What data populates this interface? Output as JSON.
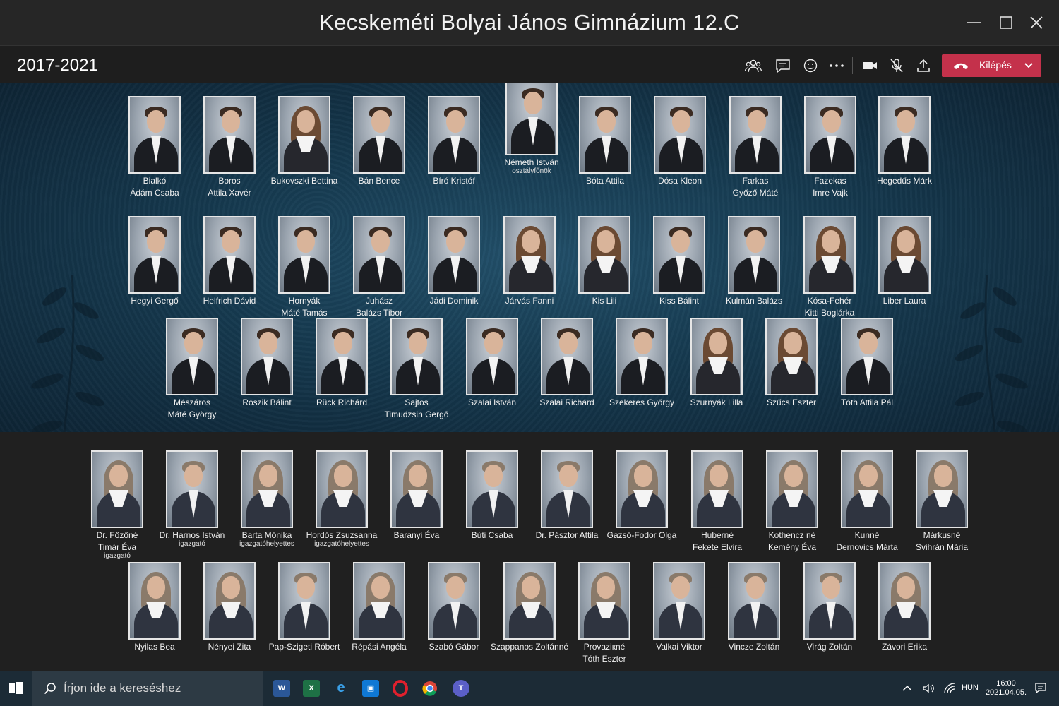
{
  "window": {
    "title": "Kecskeméti Bolyai János Gimnázium 12.C"
  },
  "meeting": {
    "date_range": "2017-2021",
    "leave_label": "Kilépés"
  },
  "students": [
    {
      "name": "Bialkó",
      "name2": "Ádám Csaba"
    },
    {
      "name": "Boros",
      "name2": "Attila Xavér"
    },
    {
      "name": "Bukovszki Bettina",
      "name2": ""
    },
    {
      "name": "Bán Bence",
      "name2": ""
    },
    {
      "name": "Bíró Kristóf",
      "name2": ""
    },
    {
      "name": "Németh István",
      "name2": "osztályfőnök"
    },
    {
      "name": "Bóta Attila",
      "name2": ""
    },
    {
      "name": "Dósa Kleon",
      "name2": ""
    },
    {
      "name": "Farkas",
      "name2": "Győző Máté"
    },
    {
      "name": "Fazekas",
      "name2": "Imre Vajk"
    },
    {
      "name": "Hegedűs Márk",
      "name2": ""
    },
    {
      "name": "Hegyi Gergő",
      "name2": ""
    },
    {
      "name": "Helfrich Dávid",
      "name2": ""
    },
    {
      "name": "Hornyák",
      "name2": "Máté Tamás"
    },
    {
      "name": "Juhász",
      "name2": "Balázs Tibor"
    },
    {
      "name": "Jádi Dominik",
      "name2": ""
    },
    {
      "name": "Járvás Fanni",
      "name2": ""
    },
    {
      "name": "Kis Lili",
      "name2": ""
    },
    {
      "name": "Kiss Bálint",
      "name2": ""
    },
    {
      "name": "Kulmán Balázs",
      "name2": ""
    },
    {
      "name": "Kósa-Fehér",
      "name2": "Kitti Boglárka"
    },
    {
      "name": "Liber Laura",
      "name2": ""
    },
    {
      "name": "Mészáros",
      "name2": "Máté György"
    },
    {
      "name": "Roszik Bálint",
      "name2": ""
    },
    {
      "name": "Rück Richárd",
      "name2": ""
    },
    {
      "name": "Sajtos",
      "name2": "Timudzsin Gergő"
    },
    {
      "name": "Szalai István",
      "name2": ""
    },
    {
      "name": "Szalai Richárd",
      "name2": ""
    },
    {
      "name": "Szekeres György",
      "name2": ""
    },
    {
      "name": "Szurnyák Lilla",
      "name2": ""
    },
    {
      "name": "Szűcs Eszter",
      "name2": ""
    },
    {
      "name": "Tóth Attila Pál",
      "name2": ""
    }
  ],
  "teachers": [
    {
      "name": "Dr. Főzőné",
      "name2": "Timár Éva",
      "role": "igazgató"
    },
    {
      "name": "Dr. Harnos István",
      "name2": "",
      "role": "igazgató"
    },
    {
      "name": "Barta Mónika",
      "name2": "",
      "role": "igazgatóhelyettes"
    },
    {
      "name": "Hordós Zsuzsanna",
      "name2": "",
      "role": "igazgatóhelyettes"
    },
    {
      "name": "Baranyi Éva",
      "name2": "",
      "role": ""
    },
    {
      "name": "Búti Csaba",
      "name2": "",
      "role": ""
    },
    {
      "name": "Dr. Pásztor Attila",
      "name2": "",
      "role": ""
    },
    {
      "name": "Gazsó-Fodor Olga",
      "name2": "",
      "role": ""
    },
    {
      "name": "Huberné",
      "name2": "Fekete Elvira",
      "role": ""
    },
    {
      "name": "Kothencz né",
      "name2": "Kemény Éva",
      "role": ""
    },
    {
      "name": "Kunné",
      "name2": "Dernovics Márta",
      "role": ""
    },
    {
      "name": "Márkusné",
      "name2": "Svihrán Mária",
      "role": ""
    },
    {
      "name": "Nyilas Bea",
      "name2": "",
      "role": ""
    },
    {
      "name": "Nényei Zita",
      "name2": "",
      "role": ""
    },
    {
      "name": "Pap-Szigeti Róbert",
      "name2": "",
      "role": ""
    },
    {
      "name": "Répási Angéla",
      "name2": "",
      "role": ""
    },
    {
      "name": "Szabó Gábor",
      "name2": "",
      "role": ""
    },
    {
      "name": "Szappanos Zoltánné",
      "name2": "",
      "role": ""
    },
    {
      "name": "Provaziкné",
      "name2": "Tóth Eszter",
      "role": ""
    },
    {
      "name": "Valkai Viktor",
      "name2": "",
      "role": ""
    },
    {
      "name": "Vincze Zoltán",
      "name2": "",
      "role": ""
    },
    {
      "name": "Virág Zoltán",
      "name2": "",
      "role": ""
    },
    {
      "name": "Závori Erika",
      "name2": "",
      "role": ""
    }
  ],
  "taskbar": {
    "search_placeholder": "Írjon ide a kereséshez",
    "language": "HUN",
    "time": "16:00",
    "date": "2021.04.05."
  },
  "colors": {
    "leave": "#c4314b",
    "tableau_bg": "#163a50",
    "taskbar": "#1c2b36"
  }
}
